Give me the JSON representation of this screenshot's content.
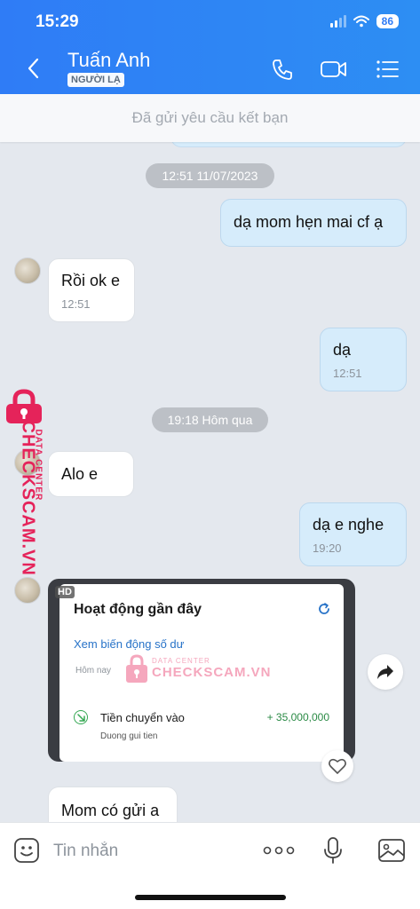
{
  "status_bar": {
    "time": "15:29",
    "battery": "86"
  },
  "header": {
    "contact_name": "Tuấn Anh",
    "badge": "NGƯỜI LẠ"
  },
  "request_bar": {
    "text": "Đã gửi yêu cầu kết bạn"
  },
  "messages": [
    {
      "type": "time",
      "text": "12:51 11/07/2023"
    },
    {
      "type": "out",
      "text": "dạ mom hẹn mai cf ạ",
      "time": ""
    },
    {
      "type": "in",
      "text": "Rồi ok e",
      "time": "12:51"
    },
    {
      "type": "out",
      "text": "dạ",
      "time": "12:51"
    },
    {
      "type": "time",
      "text": "19:18 Hôm qua"
    },
    {
      "type": "in",
      "text": "Alo e",
      "time": ""
    },
    {
      "type": "out",
      "text": "dạ e nghe",
      "time": "19:20"
    },
    {
      "type": "in",
      "text": "Mom có gửi a",
      "time": ""
    }
  ],
  "image_card": {
    "hd": "HD",
    "title": "Hoạt động gần đây",
    "link": "Xem biến động số dư",
    "today": "Hôm nay",
    "tx_title": "Tiền chuyển vào",
    "tx_amount": "+ 35,000,000",
    "tx_desc": "Duong gui tien"
  },
  "watermark": {
    "main": "CHECKSCAM.VN",
    "sub": "DATA CENTER"
  },
  "composer": {
    "placeholder": "Tin nhắn"
  },
  "colors": {
    "header": "#2f7cf6",
    "bubble_out": "#d6ecfb",
    "bubble_in": "#ffffff",
    "watermark": "#e5235a"
  }
}
